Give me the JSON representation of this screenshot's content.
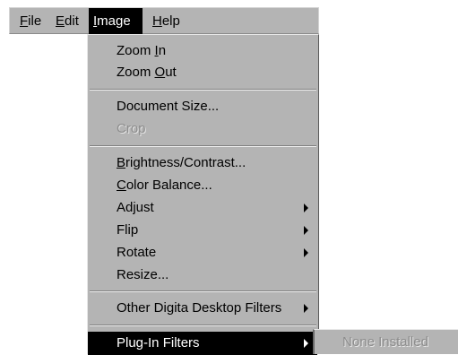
{
  "menubar": {
    "items": [
      {
        "label_u": "F",
        "label_rest": "ile"
      },
      {
        "label_u": "E",
        "label_rest": "dit"
      },
      {
        "label_u": "I",
        "label_rest": "mage"
      },
      {
        "label_u": "H",
        "label_rest": "elp"
      }
    ]
  },
  "image_menu": {
    "zoom_in": {
      "pre": "Zoom ",
      "u": "I",
      "post": "n"
    },
    "zoom_out": {
      "pre": "Zoom ",
      "u": "O",
      "post": "ut"
    },
    "document_size": "Document Size...",
    "crop": "Crop",
    "brightness": {
      "pre": "",
      "u": "B",
      "post": "rightness/Contrast..."
    },
    "color_balance": {
      "pre": "",
      "u": "C",
      "post": "olor Balance..."
    },
    "adjust": "Adjust",
    "flip": "Flip",
    "rotate": "Rotate",
    "resize": "Resize...",
    "other_filters": "Other Digita Desktop Filters",
    "plugin_filters": "Plug-In Filters"
  },
  "plugin_submenu": {
    "none_installed": "None Installed"
  }
}
